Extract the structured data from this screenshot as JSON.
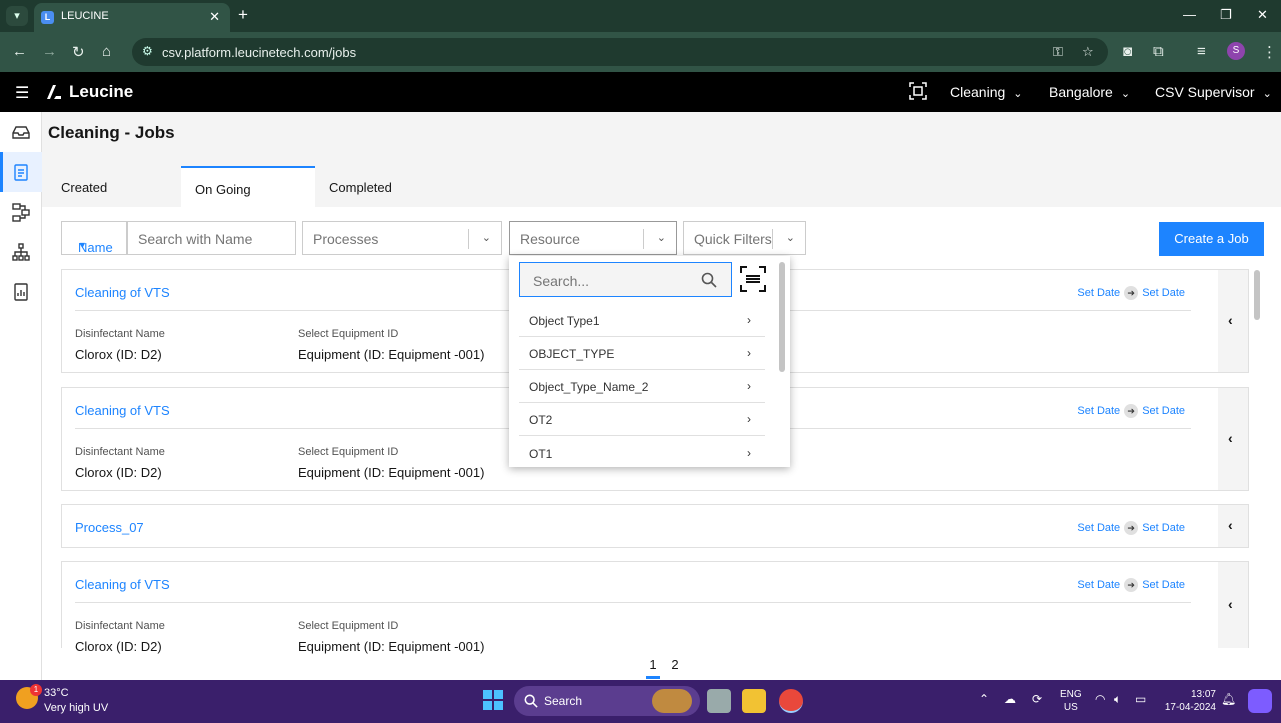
{
  "browser": {
    "tab_title": "LEUCINE",
    "url": "csv.platform.leucinetech.com/jobs",
    "profile_initial": "S"
  },
  "app": {
    "logo": "Leucine",
    "header": {
      "use_case": "Cleaning",
      "facility": "Bangalore",
      "user_role": "CSV Supervisor"
    }
  },
  "page": {
    "title": "Cleaning - Jobs",
    "tabs": [
      {
        "label": "Created"
      },
      {
        "label": "On Going"
      },
      {
        "label": "Completed"
      }
    ],
    "active_tab": "On Going"
  },
  "filters": {
    "name_dropdown": "Name",
    "search_placeholder": "Search with Name",
    "processes_placeholder": "Processes",
    "resource_placeholder": "Resource",
    "quick_filters_placeholder": "Quick Filters",
    "create_button": "Create a Job"
  },
  "resource_popup": {
    "search_placeholder": "Search...",
    "items": [
      {
        "label": "Object Type1"
      },
      {
        "label": "OBJECT_TYPE"
      },
      {
        "label": "Object_Type_Name_2"
      },
      {
        "label": "OT2"
      },
      {
        "label": "OT1"
      }
    ]
  },
  "jobs": [
    {
      "title": "Cleaning of VTS",
      "start_date": "Set Date",
      "end_date": "Set Date",
      "fields": [
        {
          "label": "Disinfectant Name",
          "value": "Clorox (ID: D2)"
        },
        {
          "label": "Select Equipment ID",
          "value": "Equipment (ID: Equipment -001)"
        }
      ]
    },
    {
      "title": "Cleaning of VTS",
      "start_date": "Set Date",
      "end_date": "Set Date",
      "fields": [
        {
          "label": "Disinfectant Name",
          "value": "Clorox (ID: D2)"
        },
        {
          "label": "Select Equipment ID",
          "value": "Equipment (ID: Equipment -001)"
        }
      ]
    },
    {
      "title": "Process_07",
      "start_date": "Set Date",
      "end_date": "Set Date",
      "fields": []
    },
    {
      "title": "Cleaning of VTS",
      "start_date": "Set Date",
      "end_date": "Set Date",
      "fields": [
        {
          "label": "Disinfectant Name",
          "value": "Clorox (ID: D2)"
        },
        {
          "label": "Select Equipment ID",
          "value": "Equipment (ID: Equipment -001)"
        }
      ]
    }
  ],
  "pagination": {
    "pages": [
      "1",
      "2"
    ],
    "current": "1"
  },
  "taskbar": {
    "weather_temp": "33°C",
    "weather_desc": "Very high UV",
    "weather_badge": "1",
    "search_label": "Search",
    "lang_line1": "ENG",
    "lang_line2": "US",
    "time": "13:07",
    "date": "17-04-2024"
  },
  "colors": {
    "accent": "#1d84ff",
    "app_header": "#000000",
    "browser_chrome": "#315446",
    "taskbar": "#3a1f6b"
  }
}
